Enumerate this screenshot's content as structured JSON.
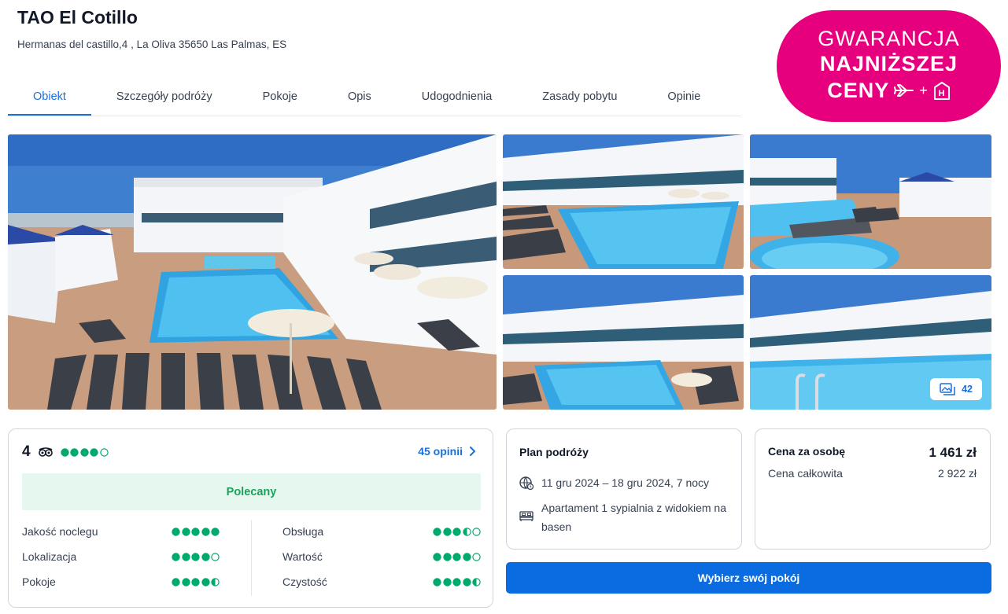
{
  "hotel": {
    "name": "TAO El Cotillo",
    "address": "Hermanas del castillo,4 , La Oliva 35650 Las Palmas, ES"
  },
  "badge": {
    "line1": "GWARANCJA",
    "line2": "NAJNIŻSZEJ",
    "line3": "CENY",
    "plus": "+",
    "hotel_letter": "H"
  },
  "tabs": [
    {
      "label": "Obiekt",
      "active": true
    },
    {
      "label": "Szczegóły podróży"
    },
    {
      "label": "Pokoje"
    },
    {
      "label": "Opis"
    },
    {
      "label": "Udogodnienia"
    },
    {
      "label": "Zasady pobytu"
    },
    {
      "label": "Opinie"
    }
  ],
  "gallery": {
    "photo_count": "42"
  },
  "rating": {
    "score": "4",
    "overall_bubbles": 4,
    "reviews_label": "45 opinii",
    "recommended_label": "Polecany",
    "categories": [
      {
        "label": "Jakość noclegu",
        "score": 5
      },
      {
        "label": "Obsługa",
        "score": 3.5
      },
      {
        "label": "Lokalizacja",
        "score": 4
      },
      {
        "label": "Wartość",
        "score": 4
      },
      {
        "label": "Pokoje",
        "score": 4.5
      },
      {
        "label": "Czystość",
        "score": 4.5
      }
    ]
  },
  "trip": {
    "title": "Plan podróży",
    "dates": "11 gru 2024 – 18 gru 2024, 7 nocy",
    "room": "Apartament 1 sypialnia z widokiem na basen"
  },
  "price": {
    "per_person_label": "Cena za osobę",
    "per_person_value": "1 461 zł",
    "total_label": "Cena całkowita",
    "total_value": "2 922 zł"
  },
  "cta": {
    "label": "Wybierz swój pokój"
  },
  "colors": {
    "accent": "#1a6fd9",
    "badge": "#e6007e",
    "rating_green": "#00aa6c",
    "button": "#0a6ce0"
  }
}
